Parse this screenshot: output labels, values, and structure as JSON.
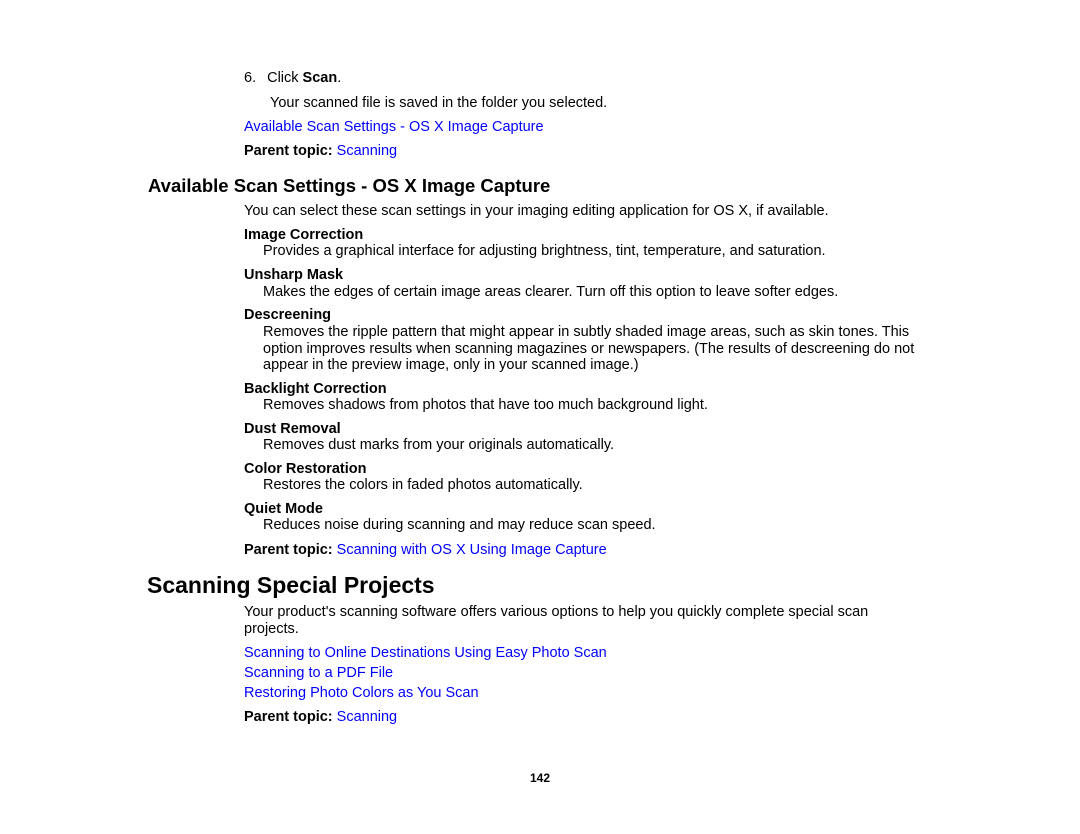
{
  "step": {
    "number": "6.",
    "prefix": "Click ",
    "bold": "Scan",
    "suffix": ".",
    "result": "Your scanned file is saved in the folder you selected."
  },
  "top_links": {
    "related_link": "Available Scan Settings - OS X Image Capture",
    "parent_label": "Parent topic:",
    "parent_link": "Scanning"
  },
  "section1": {
    "title": "Available Scan Settings - OS X Image Capture",
    "intro": "You can select these scan settings in your imaging editing application for OS X, if available.",
    "settings": [
      {
        "term": "Image Correction",
        "desc": "Provides a graphical interface for adjusting brightness, tint, temperature, and saturation."
      },
      {
        "term": "Unsharp Mask",
        "desc": "Makes the edges of certain image areas clearer. Turn off this option to leave softer edges."
      },
      {
        "term": "Descreening",
        "desc_lines": [
          "Removes the ripple pattern that might appear in subtly shaded image areas, such as skin tones. This",
          "option improves results when scanning magazines or newspapers. (The results of descreening do not",
          "appear in the preview image, only in your scanned image.)"
        ]
      },
      {
        "term": "Backlight Correction",
        "desc": "Removes shadows from photos that have too much background light."
      },
      {
        "term": "Dust Removal",
        "desc": "Removes dust marks from your originals automatically."
      },
      {
        "term": "Color Restoration",
        "desc": "Restores the colors in faded photos automatically."
      },
      {
        "term": "Quiet Mode",
        "desc": "Reduces noise during scanning and may reduce scan speed."
      }
    ],
    "parent_label": "Parent topic:",
    "parent_link": "Scanning with OS X Using Image Capture"
  },
  "section2": {
    "title": "Scanning Special Projects",
    "intro_lines": [
      "Your product's scanning software offers various options to help you quickly complete special scan",
      "projects."
    ],
    "links": [
      "Scanning to Online Destinations Using Easy Photo Scan",
      "Scanning to a PDF File",
      "Restoring Photo Colors as You Scan"
    ],
    "parent_label": "Parent topic:",
    "parent_link": "Scanning"
  },
  "footer": {
    "page_number": "142"
  },
  "colors": {
    "link": "#0000ff",
    "text": "#000000"
  }
}
